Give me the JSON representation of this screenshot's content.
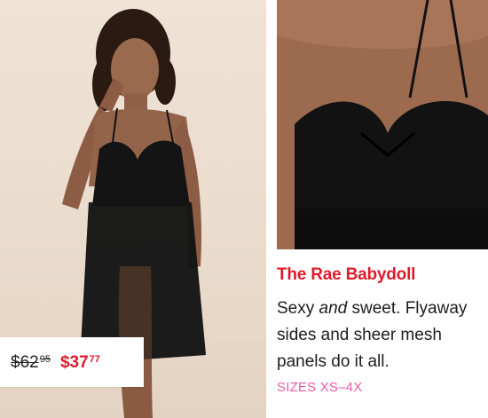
{
  "price": {
    "old_whole": "$62",
    "old_cents": "95",
    "new_whole": "$37",
    "new_cents": "77"
  },
  "product": {
    "title": "The Rae Babydoll",
    "desc_part1": "Sexy ",
    "desc_em": "and",
    "desc_part2": " sweet. Flyaway sides and sheer mesh panels do it all.",
    "sizes": "SIZES XS–4X"
  },
  "colors": {
    "accent_red": "#e01a2b",
    "sizes_pink": "#ea5aa6"
  }
}
